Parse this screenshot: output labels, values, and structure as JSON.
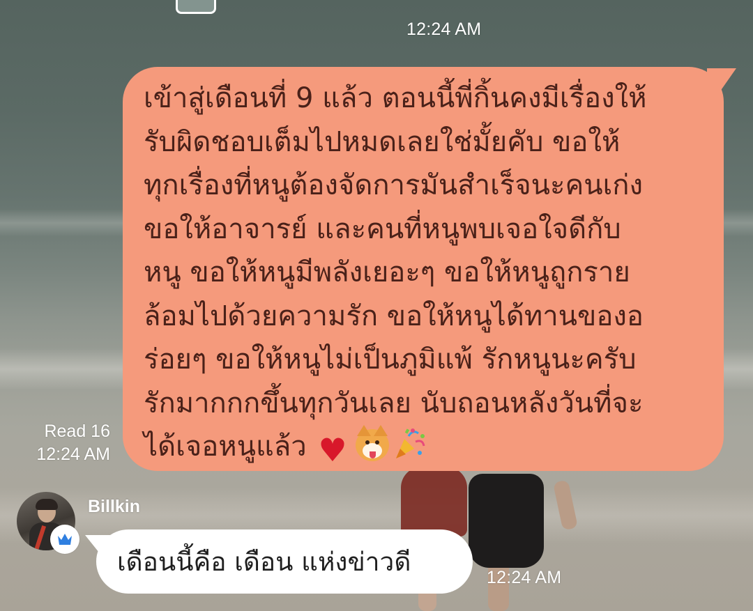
{
  "outgoing_message": {
    "text": "เข้าสู่เดือนที่ 9 แล้ว ตอนนี้พี่กิ้นคงมีเรื่องให้\nรับผิดชอบเต็มไปหมดเลยใช่มั้ยคับ ขอให้\nทุกเรื่องที่หนูต้องจัดการมันสำเร็จนะคนเก่ง\nขอให้อาจารย์ และคนที่หนูพบเจอใจดีกับ\nหนู ขอให้หนูมีพลังเยอะๆ ขอให้หนูถูกราย\nล้อมไปด้วยความรัก ขอให้หนูได้ทานของอ\nร่อยๆ ขอให้หนูไม่เป็นภูมิแพ้ รักหนูนะครับ\nรักมากกกขึ้นทุกวันเลย นับถอนหลังวันที่จะ\nได้เจอหนูแล้ว ",
    "emojis": [
      "red-heart",
      "dog-face",
      "party-popper"
    ],
    "heart_glyph": "♥",
    "bubble_color": "#f59a7c",
    "timestamp_above": "12:24 AM",
    "read_status": "Read 16",
    "read_time": "12:24 AM"
  },
  "incoming_message": {
    "sender_name": "Billkin",
    "text": "เดือนนี้คือ เดือน แห่งข่าวดี",
    "timestamp": "12:24 AM",
    "badge_icon": "crown-icon",
    "bubble_color": "#ffffff"
  }
}
